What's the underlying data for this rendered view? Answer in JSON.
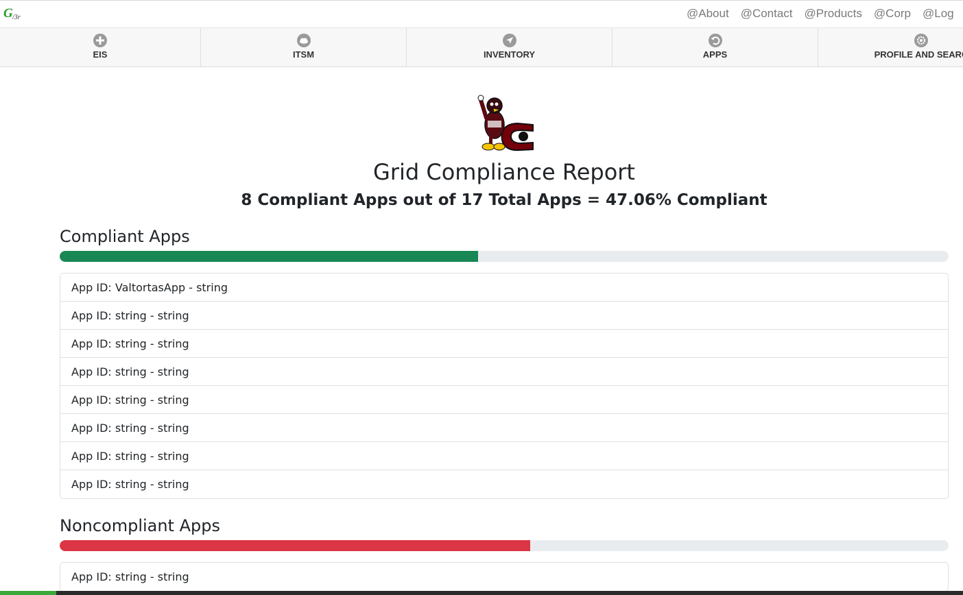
{
  "topbar": {
    "brand_logo": "grid-logo",
    "links": [
      "@About",
      "@Contact",
      "@Products",
      "@Corp",
      "@Log"
    ]
  },
  "navbar": {
    "items": [
      {
        "label": "EIS",
        "icon": "plus-circle-icon"
      },
      {
        "label": "ITSM",
        "icon": "cloud-icon"
      },
      {
        "label": "INVENTORY",
        "icon": "navigation-arrow-icon"
      },
      {
        "label": "APPS",
        "icon": "refresh-icon"
      },
      {
        "label": "PROFILE AND SEARC",
        "icon": "gear-icon"
      }
    ]
  },
  "report": {
    "logo": "gamecock-mascot-logo",
    "title": "Grid Compliance Report",
    "summary": "8 Compliant Apps out of 17 Total Apps = 47.06% Compliant"
  },
  "compliant": {
    "heading": "Compliant Apps",
    "progress_fraction": 0.4706,
    "bar_color": "#198754",
    "items": [
      "App ID: ValtortasApp - string",
      "App ID: string - string",
      "App ID: string - string",
      "App ID: string - string",
      "App ID: string - string",
      "App ID: string - string",
      "App ID: string - string",
      "App ID: string - string"
    ]
  },
  "noncompliant": {
    "heading": "Noncompliant Apps",
    "progress_fraction": 0.5294,
    "bar_color": "#dc3545",
    "items": [
      "App ID: string - string"
    ]
  }
}
